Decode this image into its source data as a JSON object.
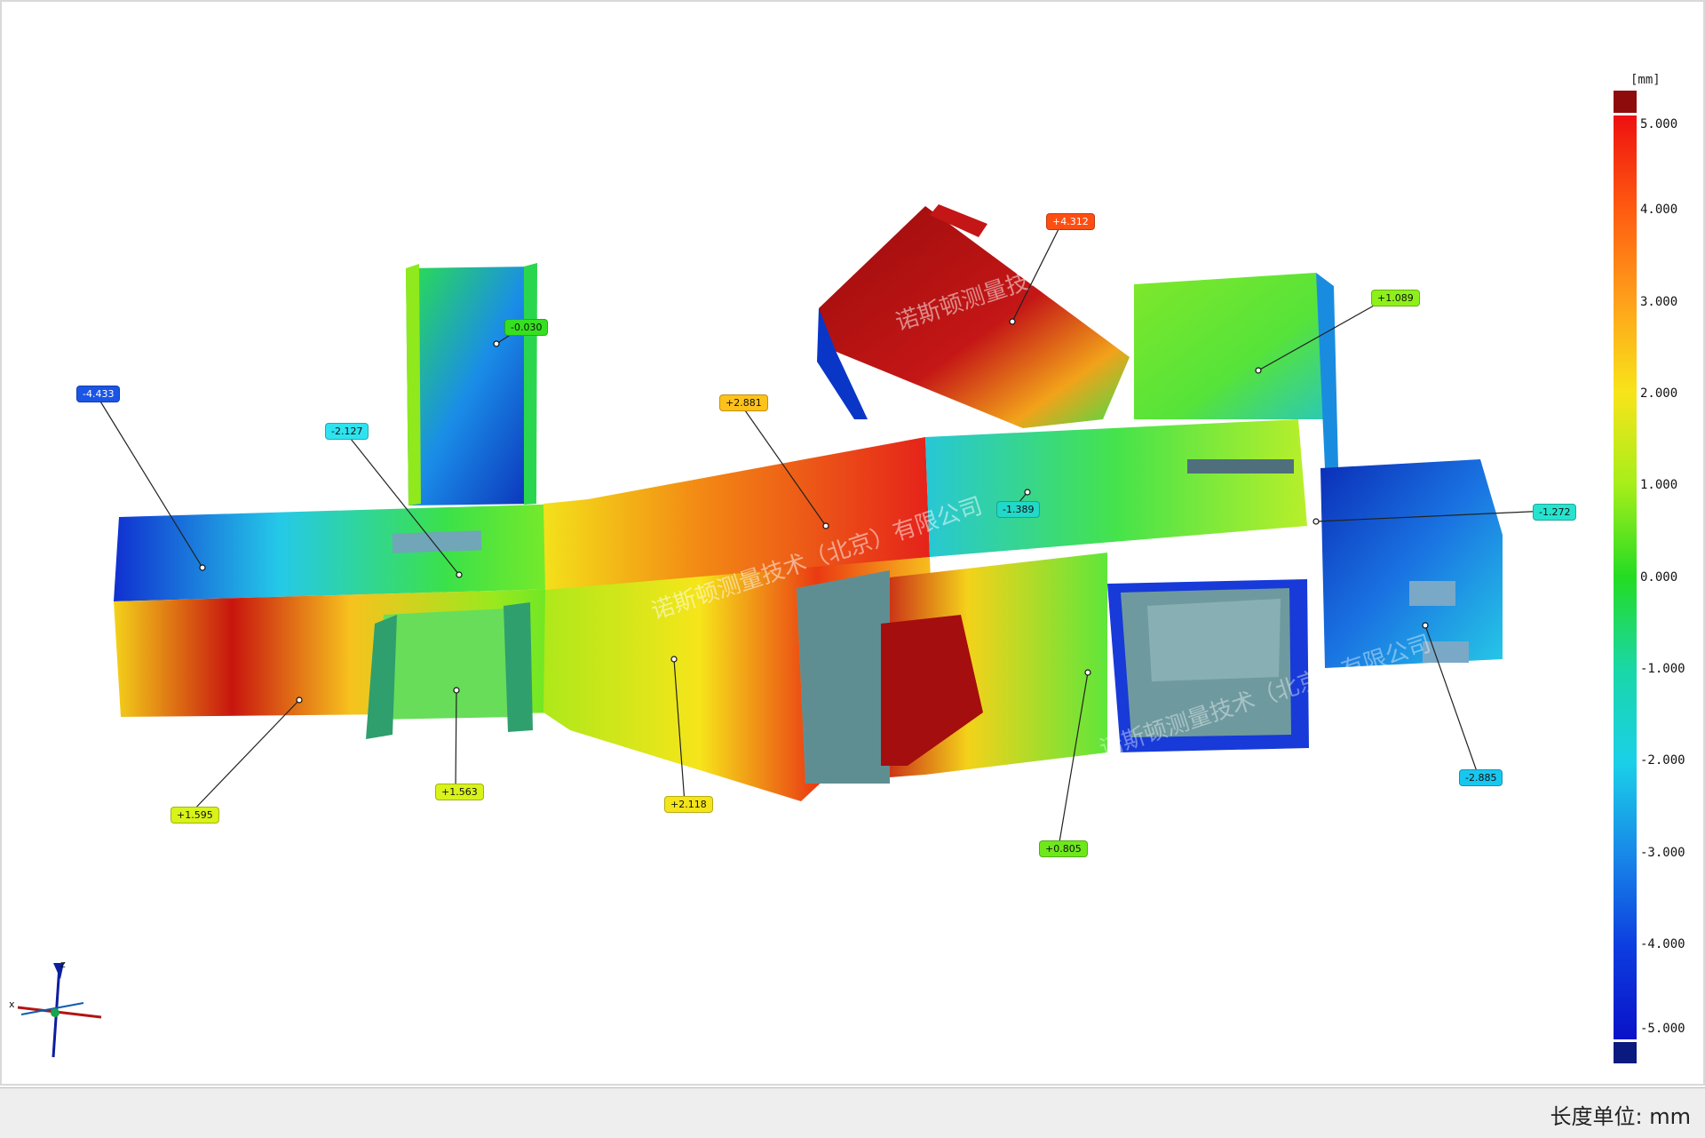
{
  "legend": {
    "unit": "[mm]",
    "ticks": [
      "5.000",
      "4.000",
      "3.000",
      "2.000",
      "1.000",
      "0.000",
      "-1.000",
      "-2.000",
      "-3.000",
      "-4.000",
      "-5.000"
    ]
  },
  "callouts": [
    {
      "label": "-4.433",
      "color": "#1b55e6",
      "text_color": "#ffffff"
    },
    {
      "label": "-2.127",
      "color": "#2ee3ef",
      "text_color": "#111111"
    },
    {
      "label": "-0.030",
      "color": "#36e020",
      "text_color": "#111111"
    },
    {
      "label": "+2.881",
      "color": "#ffc21a",
      "text_color": "#111111"
    },
    {
      "label": "+4.312",
      "color": "#ff4e12",
      "text_color": "#ffffff"
    },
    {
      "label": "+1.089",
      "color": "#8ef01a",
      "text_color": "#111111"
    },
    {
      "label": "-1.389",
      "color": "#22d8c8",
      "text_color": "#111111"
    },
    {
      "label": "-1.272",
      "color": "#26e3cf",
      "text_color": "#111111"
    },
    {
      "label": "+1.595",
      "color": "#d8f21a",
      "text_color": "#111111"
    },
    {
      "label": "+1.563",
      "color": "#d8f21a",
      "text_color": "#111111"
    },
    {
      "label": "+2.118",
      "color": "#f4e41a",
      "text_color": "#111111"
    },
    {
      "label": "+0.805",
      "color": "#6ee81a",
      "text_color": "#111111"
    },
    {
      "label": "-2.885",
      "color": "#18c7ef",
      "text_color": "#111111"
    }
  ],
  "axes": {
    "z": "z",
    "x": "x"
  },
  "watermark": "诺斯顿测量技术（北京）有限公司",
  "footer": {
    "unit_text": "长度单位: mm"
  }
}
